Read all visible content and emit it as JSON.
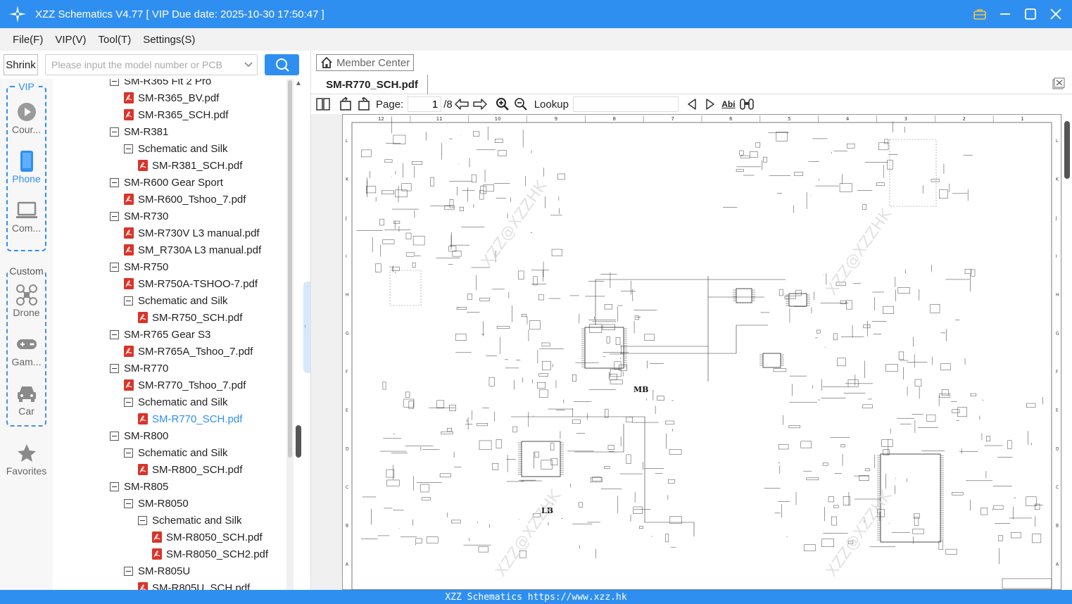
{
  "window": {
    "title": "XZZ Schematics V4.77 [ VIP Due date: 2025-10-30 17:50:47 ]"
  },
  "menu": [
    "File(F)",
    "VIP(V)",
    "Tool(T)",
    "Settings(S)"
  ],
  "toolbar": {
    "shrink_label": "Shrink",
    "search_placeholder": "Please input the model number or PCB"
  },
  "categories": {
    "vip_label": "VIP",
    "custom_label": "Custom",
    "items": [
      {
        "label": "Cour...",
        "icon": "play-icon"
      },
      {
        "label": "Phone",
        "icon": "phone-icon"
      },
      {
        "label": "Com...",
        "icon": "laptop-icon"
      },
      {
        "label": "Drone",
        "icon": "drone-icon"
      },
      {
        "label": "Gam...",
        "icon": "gamepad-icon"
      },
      {
        "label": "Car",
        "icon": "car-icon"
      },
      {
        "label": "Favorites",
        "icon": "star-icon"
      }
    ]
  },
  "tree": [
    {
      "label": "SM-R365 Fit 2 Pro",
      "level": 0,
      "type": "folder"
    },
    {
      "label": "SM-R365_BV.pdf",
      "level": 1,
      "type": "pdf"
    },
    {
      "label": "SM-R365_SCH.pdf",
      "level": 1,
      "type": "pdf"
    },
    {
      "label": "SM-R381",
      "level": 0,
      "type": "folder"
    },
    {
      "label": "Schematic and Silk",
      "level": 1,
      "type": "folder"
    },
    {
      "label": "SM-R381_SCH.pdf",
      "level": 2,
      "type": "pdf"
    },
    {
      "label": "SM-R600 Gear Sport",
      "level": 0,
      "type": "folder"
    },
    {
      "label": "SM-R600_Tshoo_7.pdf",
      "level": 1,
      "type": "pdf"
    },
    {
      "label": "SM-R730",
      "level": 0,
      "type": "folder"
    },
    {
      "label": "SM-R730V L3 manual.pdf",
      "level": 1,
      "type": "pdf"
    },
    {
      "label": "SM_R730A L3 manual.pdf",
      "level": 1,
      "type": "pdf"
    },
    {
      "label": "SM-R750",
      "level": 0,
      "type": "folder"
    },
    {
      "label": "SM-R750A-TSHOO-7.pdf",
      "level": 1,
      "type": "pdf"
    },
    {
      "label": "Schematic and Silk",
      "level": 1,
      "type": "folder"
    },
    {
      "label": "SM-R750_SCH.pdf",
      "level": 2,
      "type": "pdf"
    },
    {
      "label": "SM-R765 Gear S3",
      "level": 0,
      "type": "folder"
    },
    {
      "label": "SM-R765A_Tshoo_7.pdf",
      "level": 1,
      "type": "pdf"
    },
    {
      "label": "SM-R770",
      "level": 0,
      "type": "folder"
    },
    {
      "label": "SM-R770_Tshoo_7.pdf",
      "level": 1,
      "type": "pdf"
    },
    {
      "label": "Schematic and Silk",
      "level": 1,
      "type": "folder"
    },
    {
      "label": "SM-R770_SCH.pdf",
      "level": 2,
      "type": "pdf",
      "selected": true
    },
    {
      "label": "SM-R800",
      "level": 0,
      "type": "folder"
    },
    {
      "label": "Schematic and Silk",
      "level": 1,
      "type": "folder"
    },
    {
      "label": "SM-R800_SCH.pdf",
      "level": 2,
      "type": "pdf"
    },
    {
      "label": "SM-R805",
      "level": 0,
      "type": "folder"
    },
    {
      "label": "SM-R8050",
      "level": 1,
      "type": "folder"
    },
    {
      "label": "Schematic and Silk",
      "level": 2,
      "type": "folder"
    },
    {
      "label": "SM-R8050_SCH.pdf",
      "level": 3,
      "type": "pdf"
    },
    {
      "label": "SM-R8050_SCH2.pdf",
      "level": 3,
      "type": "pdf"
    },
    {
      "label": "SM-R805U",
      "level": 1,
      "type": "folder"
    },
    {
      "label": "SM-R805U_SCH.pdf",
      "level": 2,
      "type": "pdf"
    }
  ],
  "member_center": "Member Center",
  "tab": {
    "label": "SM-R770_SCH.pdf"
  },
  "pdf_toolbar": {
    "page_label": "Page:",
    "page_value": "1",
    "page_total": "/8",
    "lookup_label": "Lookup",
    "abi": "Abi"
  },
  "schematic": {
    "columns": [
      "12",
      "11",
      "10",
      "9",
      "8",
      "7",
      "6",
      "5",
      "4",
      "3",
      "2",
      "1"
    ],
    "rows": [
      "L",
      "K",
      "J",
      "I",
      "H",
      "G",
      "F",
      "E",
      "D",
      "C",
      "B",
      "A"
    ],
    "labels": [
      "MB",
      "LB"
    ],
    "watermark": "XZZ@XZZHK"
  },
  "status": "XZZ Schematics https://www.xzz.hk",
  "colors": {
    "accent": "#2f8ff0",
    "pdf_red": "#d9342b",
    "selected": "#2f8ff0"
  }
}
